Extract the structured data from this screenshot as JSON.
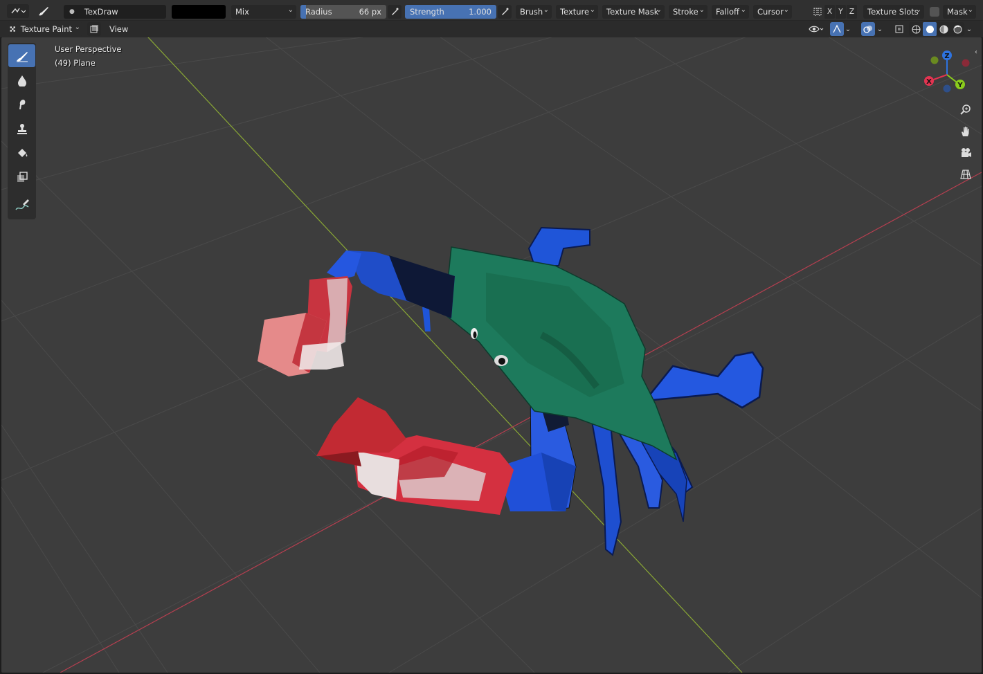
{
  "header": {
    "mode_icon": "editor-type-3d-viewport-icon",
    "brush_icon": "paintbrush-icon",
    "brush_name": "TexDraw",
    "color_value": "#000000",
    "blend_mode": "Mix",
    "radius": {
      "label": "Radius",
      "value": "66 px"
    },
    "strength": {
      "label": "Strength",
      "value": "1.000",
      "fraction": 1.0
    },
    "menus": [
      "Brush",
      "Texture",
      "Texture Mask",
      "Stroke",
      "Falloff",
      "Cursor"
    ],
    "mirror_axes": [
      "X",
      "Y",
      "Z"
    ],
    "texture_slots": "Texture Slots",
    "mask": "Mask"
  },
  "header2": {
    "mode": "Texture Paint",
    "view_menu": "View"
  },
  "viewport": {
    "perspective_label": "User Perspective",
    "object_label": "(49) Plane",
    "gizmo_axes": [
      "X",
      "Y",
      "Z"
    ],
    "nav_icons": [
      "zoom-icon",
      "hand-pan-icon",
      "camera-icon",
      "grid-ortho-icon"
    ],
    "tools": [
      "draw-brush-icon",
      "soften-icon",
      "smear-icon",
      "clone-stamp-icon",
      "fill-icon",
      "mask-icon",
      "annotate-icon"
    ]
  },
  "colors": {
    "accent": "#4772b3",
    "grid_background": "#3d3d3d",
    "axis_x": "#b63f50",
    "axis_y": "#8aa835",
    "crab_shell": "#1d7a5c",
    "crab_blue": "#1e4fd0",
    "crab_red": "#c4252f"
  }
}
